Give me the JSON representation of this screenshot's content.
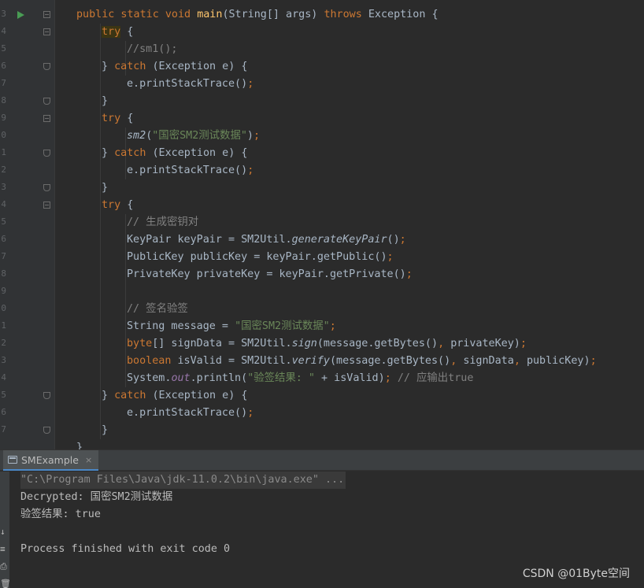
{
  "editor": {
    "line_numbers": [
      "3",
      "4",
      "5",
      "6",
      "7",
      "8",
      "9",
      "0",
      "1",
      "2",
      "3",
      "4",
      "5",
      "6",
      "7",
      "8",
      "9",
      "0",
      "1",
      "2",
      "3",
      "4",
      "5",
      "6",
      "7"
    ],
    "code_lines": [
      [
        {
          "t": "public static void ",
          "c": "kw"
        },
        {
          "t": "main",
          "c": "fn"
        },
        {
          "t": "(String[] args) "
        },
        {
          "t": "throws ",
          "c": "kw"
        },
        {
          "t": "Exception {"
        }
      ],
      [
        {
          "t": "try",
          "c": "kw hl"
        },
        {
          "t": " {"
        }
      ],
      [
        {
          "t": "//sm1();",
          "c": "cm"
        }
      ],
      [
        {
          "t": "} "
        },
        {
          "t": "catch ",
          "c": "kw"
        },
        {
          "t": "(Exception e) {"
        }
      ],
      [
        {
          "t": "e.printStackTrace()"
        },
        {
          "t": ";",
          "c": "kw"
        }
      ],
      [
        {
          "t": "}"
        }
      ],
      [
        {
          "t": "try",
          "c": "kw"
        },
        {
          "t": " {"
        }
      ],
      [
        {
          "t": "sm2",
          "c": "it"
        },
        {
          "t": "("
        },
        {
          "t": "\"国密SM2测试数据\"",
          "c": "st"
        },
        {
          "t": ")"
        },
        {
          "t": ";",
          "c": "kw"
        }
      ],
      [
        {
          "t": "} "
        },
        {
          "t": "catch ",
          "c": "kw"
        },
        {
          "t": "(Exception e) {"
        }
      ],
      [
        {
          "t": "e.printStackTrace()"
        },
        {
          "t": ";",
          "c": "kw"
        }
      ],
      [
        {
          "t": "}"
        }
      ],
      [
        {
          "t": "try",
          "c": "kw"
        },
        {
          "t": " {"
        }
      ],
      [
        {
          "t": "// 生成密钥对",
          "c": "cm"
        }
      ],
      [
        {
          "t": "KeyPair keyPair = SM2Util."
        },
        {
          "t": "generateKeyPair",
          "c": "it"
        },
        {
          "t": "()"
        },
        {
          "t": ";",
          "c": "kw"
        }
      ],
      [
        {
          "t": "PublicKey publicKey = keyPair.getPublic()"
        },
        {
          "t": ";",
          "c": "kw"
        }
      ],
      [
        {
          "t": "PrivateKey privateKey = keyPair.getPrivate()"
        },
        {
          "t": ";",
          "c": "kw"
        }
      ],
      [],
      [
        {
          "t": "// 签名验签",
          "c": "cm"
        }
      ],
      [
        {
          "t": "String message = "
        },
        {
          "t": "\"国密SM2测试数据\"",
          "c": "st"
        },
        {
          "t": ";",
          "c": "kw"
        }
      ],
      [
        {
          "t": "byte",
          "c": "kw"
        },
        {
          "t": "[] signData = SM2Util."
        },
        {
          "t": "sign",
          "c": "it"
        },
        {
          "t": "(message.getBytes()"
        },
        {
          "t": ", ",
          "c": "kw"
        },
        {
          "t": "privateKey)"
        },
        {
          "t": ";",
          "c": "kw"
        }
      ],
      [
        {
          "t": "boolean ",
          "c": "kw"
        },
        {
          "t": "isValid = SM2Util."
        },
        {
          "t": "verify",
          "c": "it"
        },
        {
          "t": "(message.getBytes()"
        },
        {
          "t": ", ",
          "c": "kw"
        },
        {
          "t": "signData"
        },
        {
          "t": ", ",
          "c": "kw"
        },
        {
          "t": "publicKey)"
        },
        {
          "t": ";",
          "c": "kw"
        }
      ],
      [
        {
          "t": "System."
        },
        {
          "t": "out",
          "c": "fld"
        },
        {
          "t": ".println("
        },
        {
          "t": "\"验签结果: \"",
          "c": "st"
        },
        {
          "t": " + isValid)"
        },
        {
          "t": "; ",
          "c": "kw"
        },
        {
          "t": "// 应输出true",
          "c": "cm"
        }
      ],
      [
        {
          "t": "} "
        },
        {
          "t": "catch ",
          "c": "kw"
        },
        {
          "t": "(Exception e) {"
        }
      ],
      [
        {
          "t": "e.printStackTrace()"
        },
        {
          "t": ";",
          "c": "kw"
        }
      ],
      [
        {
          "t": "}"
        }
      ]
    ]
  },
  "run_panel": {
    "tab_label": "SMExample",
    "tab_close": "×",
    "side_buttons": [
      "↓",
      "≡",
      "⎙",
      "🗑"
    ],
    "output_lines": [
      "\"C:\\Program Files\\Java\\jdk-11.0.2\\bin\\java.exe\" ...",
      "Decrypted: 国密SM2测试数据",
      "验签结果: true",
      "",
      "Process finished with exit code 0"
    ]
  },
  "watermark": "CSDN @01Byte空间",
  "colors": {
    "editor_bg": "#2b2b2b",
    "gutter_bg": "#313335",
    "keyword": "#cc7832",
    "method": "#ffc66d",
    "string": "#6a8759",
    "comment": "#808080",
    "field": "#9876aa",
    "text": "#a9b7c6",
    "run_icon": "#499c54"
  }
}
